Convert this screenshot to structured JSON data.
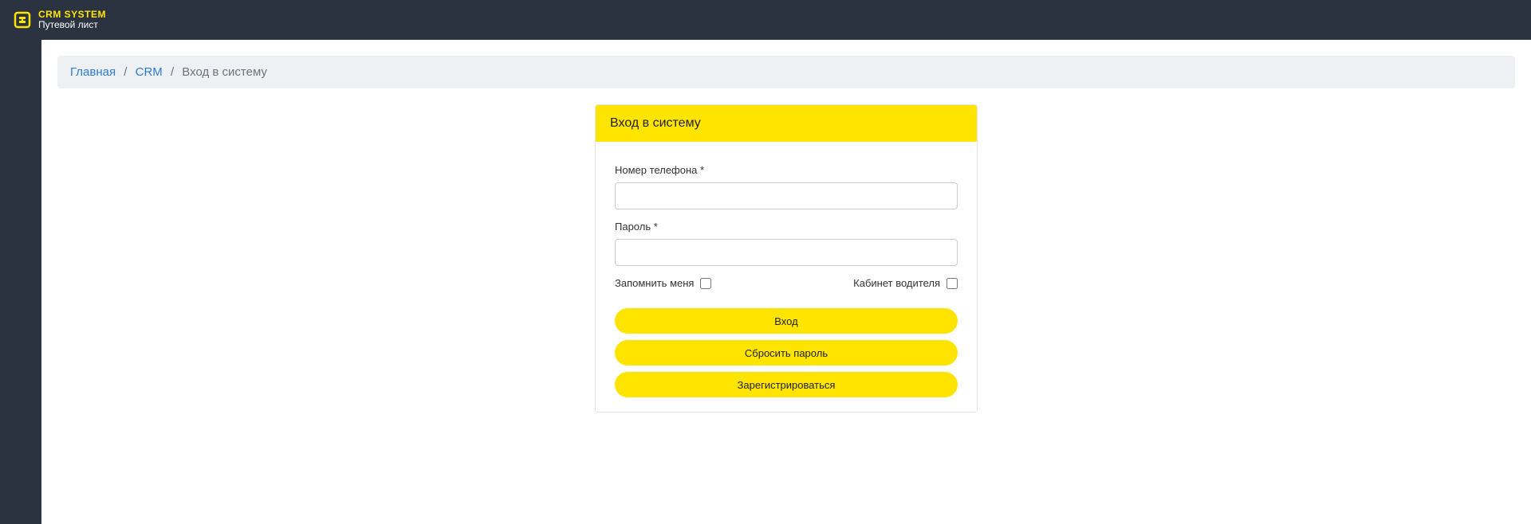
{
  "header": {
    "logo_title": "CRM SYSTEM",
    "logo_sub": "Путевой лист"
  },
  "breadcrumb": {
    "home": "Главная",
    "crm": "CRM",
    "current": "Вход в систему",
    "sep": "/"
  },
  "login": {
    "title": "Вход в систему",
    "phone_label": "Номер телефона *",
    "phone_value": "",
    "password_label": "Пароль *",
    "password_value": "",
    "remember_label": "Запомнить меня",
    "driver_label": "Кабинет водителя",
    "login_button": "Вход",
    "reset_button": "Сбросить пароль",
    "register_button": "Зарегистрироваться"
  },
  "colors": {
    "accent": "#ffe400",
    "dark": "#2b3340",
    "link": "#2b7cd3"
  }
}
